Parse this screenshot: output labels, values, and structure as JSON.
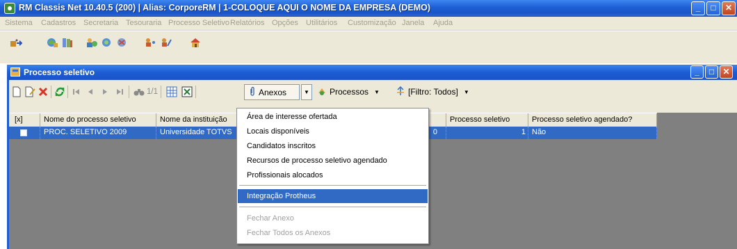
{
  "app": {
    "title": "RM Classis Net 10.40.5 (200) | Alias: CorporeRM | 1-COLOQUE AQUI O NOME DA EMPRESA (DEMO)",
    "window_buttons": [
      "_",
      "□",
      "✕"
    ]
  },
  "menubar": {
    "items": [
      "Sistema",
      "Cadastros",
      "Secretaria",
      "Tesouraria",
      "Processo Seletivo",
      "Relatórios",
      "Opções",
      "Utilitários",
      "Customização",
      "Janela",
      "Ajuda"
    ]
  },
  "child_window": {
    "title": "Processo seletivo"
  },
  "grid_toolbar": {
    "page_indicator": "1/1",
    "anexos_label": "Anexos",
    "processos_label": "Processos",
    "filtro_label": "[Filtro: Todos]"
  },
  "grid": {
    "columns": [
      "[x]",
      "Nome do processo seletivo",
      "Nome da instituição",
      "",
      "Processo seletivo",
      "Processo seletivo agendado?"
    ],
    "rows": [
      {
        "nome": "PROC. SELETIVO 2009",
        "instituicao": "Universidade TOTVS",
        "hidden_value": "0",
        "processo": "1",
        "agendado": "Não"
      }
    ]
  },
  "anexos_menu": {
    "items": [
      {
        "label": "Área de interesse ofertada",
        "state": "normal"
      },
      {
        "label": "Locais disponíveis",
        "state": "normal"
      },
      {
        "label": "Candidatos inscritos",
        "state": "normal"
      },
      {
        "label": "Recursos de processo seletivo agendado",
        "state": "normal"
      },
      {
        "label": "Profissionais alocados",
        "state": "normal"
      },
      {
        "label": "Integração Protheus",
        "state": "selected"
      },
      {
        "label": "Fechar Anexo",
        "state": "disabled"
      },
      {
        "label": "Fechar Todos os Anexos",
        "state": "disabled"
      }
    ]
  },
  "colors": {
    "titlebar": "#1f5fd6",
    "selection": "#316ac5",
    "chrome": "#ece9d8",
    "grid_background": "#808080"
  }
}
